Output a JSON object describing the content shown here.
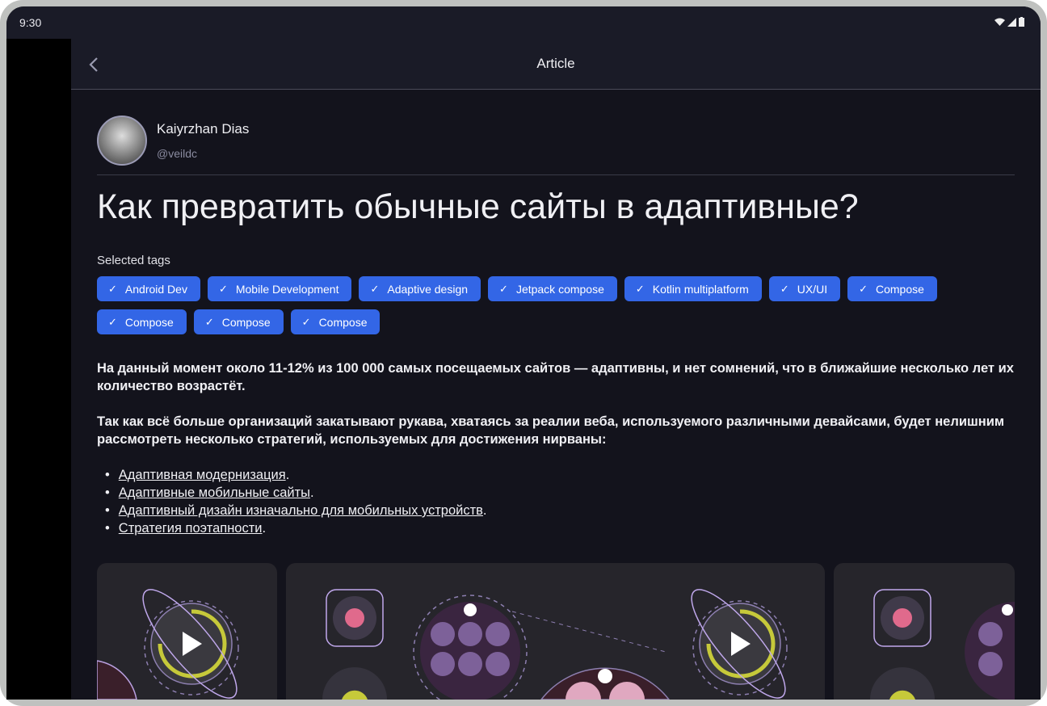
{
  "status_bar": {
    "time": "9:30"
  },
  "app_bar": {
    "title": "Article"
  },
  "author": {
    "name": "Kaiyrzhan Dias",
    "handle": "@veildc"
  },
  "article": {
    "title": "Как превратить обычные сайты в адаптивные?",
    "tags_label": "Selected tags",
    "tags": [
      "Android Dev",
      "Mobile Development",
      "Adaptive design",
      "Jetpack compose",
      "Kotlin multiplatform",
      "UX/UI",
      "Compose",
      "Compose",
      "Compose",
      "Compose"
    ],
    "paragraphs": [
      "На данный момент около 11-12% из 100 000 самых посещаемых сайтов —  адаптивны, и нет сомнений, что в ближайшие несколько лет их количество  возрастёт.",
      "Так как всё больше организаций закатывают рукава, хватаясь за реалии  веба, используемого различными девайсами, будет нелишним рассмотреть  несколько стратегий, используемых для достижения нирваны:"
    ],
    "list": [
      "Адаптивная модернизация",
      "Адаптивные мобильные сайты",
      "Адаптивный дизайн изначально для мобильных устройств",
      "Стратегия поэтапности"
    ],
    "list_suffix": "."
  },
  "colors": {
    "accent": "#3366e6",
    "background": "#13131c",
    "appbar": "#1a1b27"
  }
}
